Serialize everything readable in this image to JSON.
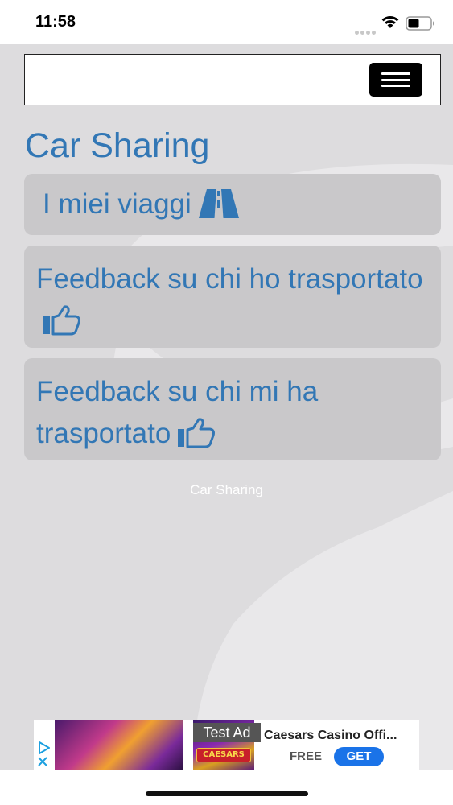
{
  "status_bar": {
    "time": "11:58",
    "icons": [
      "cellular-dots-icon",
      "wifi-icon",
      "battery-icon"
    ]
  },
  "navbar": {
    "toggle_icon": "hamburger-menu-icon"
  },
  "page": {
    "title": "Car Sharing",
    "footer": "Car Sharing"
  },
  "menu": [
    {
      "label": "I miei viaggi",
      "icon": "road-icon"
    },
    {
      "label": " Feedback su chi ho trasportato",
      "icon": "thumbs-up-icon"
    },
    {
      "label": " Feedback su chi mi ha trasportato",
      "icon": "thumbs-up-icon"
    }
  ],
  "ad": {
    "badge": "Test Ad",
    "title": "Caesars Casino Offi...",
    "logo_text": "CAESARS",
    "price": "FREE",
    "cta": "GET"
  },
  "colors": {
    "accent": "#3277b5",
    "background": "#dddcde",
    "card": "#c9c8ca",
    "cta": "#1a73e8"
  }
}
